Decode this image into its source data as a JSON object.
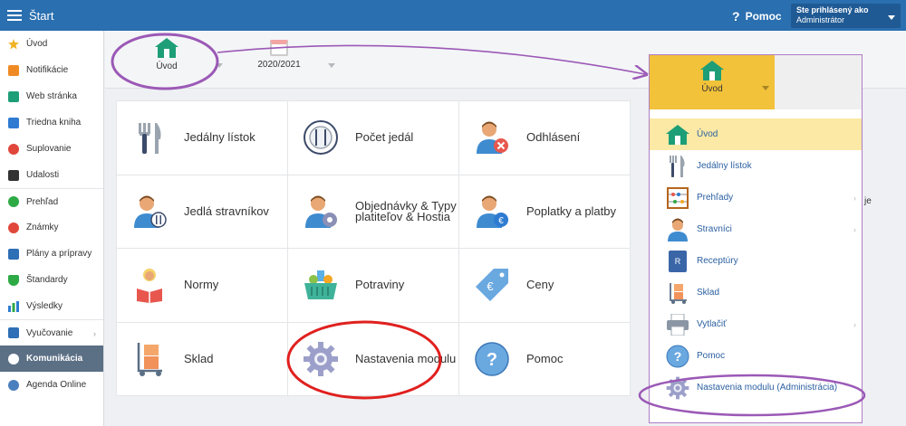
{
  "topbar": {
    "title": "Štart",
    "help": "Pomoc",
    "user_line1": "Ste prihlásený ako",
    "user_line2": "Administrátor"
  },
  "sidebar": {
    "items": [
      {
        "label": "Úvod",
        "icon": "star-icon",
        "color": "#f0b323"
      },
      {
        "label": "Notifikácie",
        "icon": "envelope-icon",
        "color": "#f08a24"
      },
      {
        "label": "Web stránka",
        "icon": "house-icon",
        "color": "#1e9e77"
      },
      {
        "label": "Triedna kniha",
        "icon": "book-icon",
        "color": "#2e7bd1"
      },
      {
        "label": "Suplovanie",
        "icon": "person-swap-icon",
        "color": "#e0473a"
      },
      {
        "label": "Udalosti",
        "icon": "calendar-icon",
        "color": "#333333"
      },
      {
        "label": "Prehľad",
        "icon": "check-circle-icon",
        "color": "#2eaa45"
      },
      {
        "label": "Známky",
        "icon": "grade-icon",
        "color": "#e0473a"
      },
      {
        "label": "Plány a prípravy",
        "icon": "briefcase-icon",
        "color": "#2e6fb5"
      },
      {
        "label": "Štandardy",
        "icon": "shield-icon",
        "color": "#2eaa45"
      },
      {
        "label": "Výsledky",
        "icon": "bars-icon",
        "color": "#2e7bd1"
      },
      {
        "label": "Vyučovanie",
        "icon": "slides-icon",
        "color": "#2e6fb5"
      },
      {
        "label": "Komunikácia",
        "icon": "chat-icon",
        "color": "#ffffff"
      },
      {
        "label": "Agenda Online",
        "icon": "pen-icon",
        "color": "#4a7fbf"
      }
    ]
  },
  "toolbar": {
    "home_label": "Úvod",
    "year_label": "2020/2021"
  },
  "tiles": [
    {
      "label": "Jedálny lístok",
      "icon": "cutlery-icon"
    },
    {
      "label": "Počet jedál",
      "icon": "plate-icon"
    },
    {
      "label": "Odhlásení",
      "icon": "person-cancel-icon"
    },
    {
      "label": "Jedlá stravníkov",
      "icon": "person-food-icon"
    },
    {
      "label": "Objednávky & Typy platiteľov & Hostia",
      "icon": "person-gear-icon"
    },
    {
      "label": "Poplatky a platby",
      "icon": "person-euro-icon"
    },
    {
      "label": "Normy",
      "icon": "reading-person-icon"
    },
    {
      "label": "Potraviny",
      "icon": "basket-icon"
    },
    {
      "label": "Ceny",
      "icon": "price-tag-icon"
    },
    {
      "label": "Sklad",
      "icon": "hand-truck-icon"
    },
    {
      "label": "Nastavenia modulu",
      "icon": "gear-icon"
    },
    {
      "label": "Pomoc",
      "icon": "help-icon"
    }
  ],
  "extra_text": "je",
  "dropdown": {
    "head_label": "Úvod",
    "items": [
      {
        "label": "Úvod",
        "icon": "house-icon",
        "selected": true,
        "arrow": false
      },
      {
        "label": "Jedálny lístok",
        "icon": "cutlery-icon",
        "selected": false,
        "arrow": false
      },
      {
        "label": "Prehľady",
        "icon": "abacus-icon",
        "selected": false,
        "arrow": true
      },
      {
        "label": "Stravníci",
        "icon": "person-icon",
        "selected": false,
        "arrow": true
      },
      {
        "label": "Receptúry",
        "icon": "recipe-book-icon",
        "selected": false,
        "arrow": false
      },
      {
        "label": "Sklad",
        "icon": "hand-truck-icon",
        "selected": false,
        "arrow": false
      },
      {
        "label": "Vytlačiť",
        "icon": "printer-icon",
        "selected": false,
        "arrow": true
      },
      {
        "label": "Pomoc",
        "icon": "help-icon",
        "selected": false,
        "arrow": false
      },
      {
        "label": "Nastavenia modulu (Administrácia)",
        "icon": "gear-icon",
        "selected": false,
        "arrow": false
      }
    ]
  },
  "colors": {
    "topbar": "#2a6fb0",
    "accent_yellow": "#f2c23a",
    "annotation_purple": "#9b59b6",
    "annotation_red": "#e0201e"
  }
}
